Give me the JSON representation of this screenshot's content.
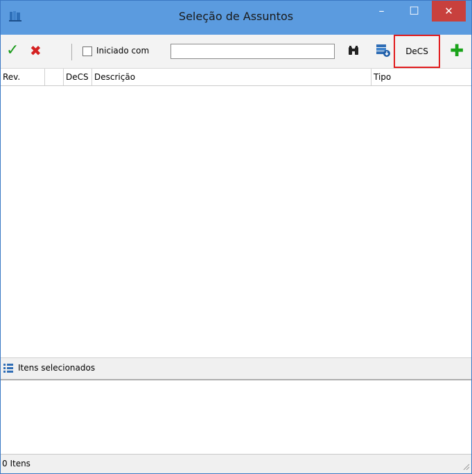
{
  "window": {
    "title": "Seleção de Assuntos",
    "minimize_glyph": "–",
    "maximize_glyph": "☐",
    "close_glyph": "✕"
  },
  "toolbar": {
    "confirm_icon": "check-icon",
    "cancel_icon": "x-icon",
    "starts_with_label": "Iniciado com",
    "starts_with_checked": false,
    "search_value": "",
    "search_icon": "binoculars-icon",
    "database_icon": "database-icon",
    "decs_label": "DeCS",
    "add_icon": "plus-icon",
    "highlight_color": "#e1191b"
  },
  "grid": {
    "columns": [
      "Rev.",
      "",
      "DeCS",
      "Descrição",
      "Tipo"
    ],
    "rows": []
  },
  "selected": {
    "header_label": "Itens selecionados",
    "items": []
  },
  "status": {
    "count_label": "0 Itens"
  },
  "colors": {
    "titlebar": "#5b9bdf",
    "close_button": "#c8403d",
    "confirm": "#199a19",
    "cancel": "#d42121",
    "add": "#1aa31a"
  }
}
